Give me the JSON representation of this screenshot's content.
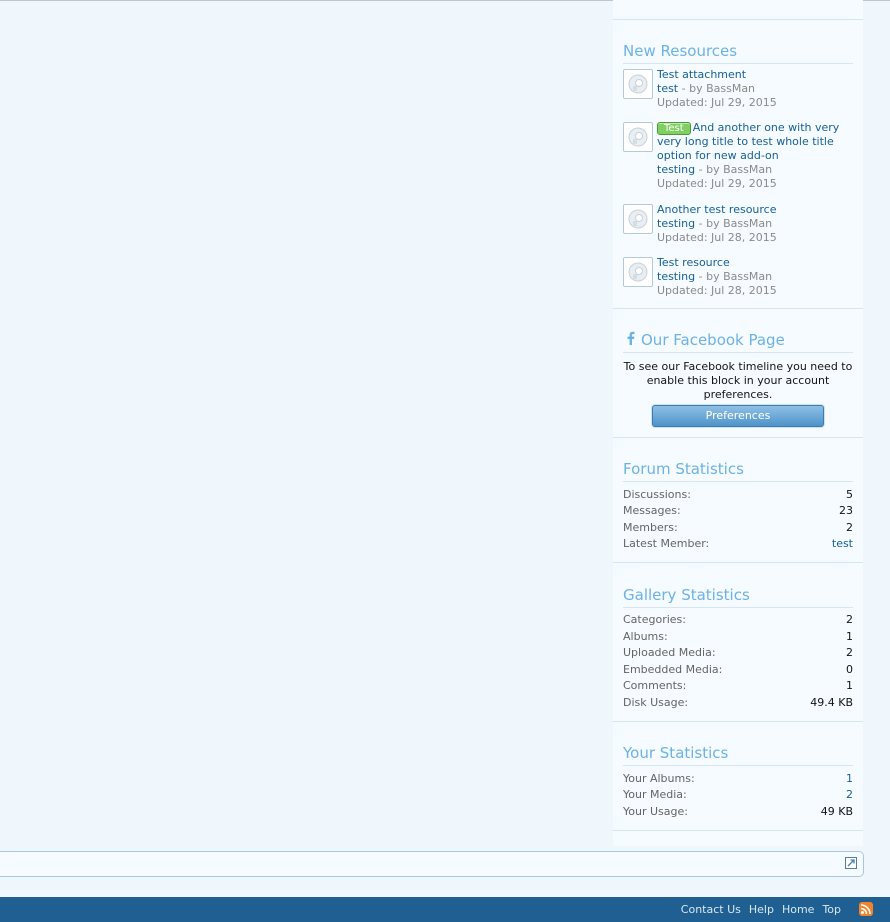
{
  "new_resources": {
    "title": "New Resources",
    "items": [
      {
        "title": "Test attachment",
        "prefix": "",
        "category": "test",
        "author": "- by BassMan",
        "updated": "Updated: Jul 29, 2015"
      },
      {
        "title": "And another one with very very long title to test whole title option for new add-on",
        "prefix": "Test",
        "category": "testing",
        "author": "- by BassMan",
        "updated": "Updated: Jul 29, 2015"
      },
      {
        "title": "Another test resource",
        "prefix": "",
        "category": "testing",
        "author": "- by BassMan",
        "updated": "Updated: Jul 28, 2015"
      },
      {
        "title": "Test resource",
        "prefix": "",
        "category": "testing",
        "author": "- by BassMan",
        "updated": "Updated: Jul 28, 2015"
      }
    ]
  },
  "facebook": {
    "title": "Our Facebook Page",
    "message": "To see our Facebook timeline you need to enable this block in your account preferences.",
    "button": "Preferences"
  },
  "forum_stats": {
    "title": "Forum Statistics",
    "rows": [
      {
        "label": "Discussions:",
        "value": "5"
      },
      {
        "label": "Messages:",
        "value": "23"
      },
      {
        "label": "Members:",
        "value": "2"
      },
      {
        "label": "Latest Member:",
        "value": "test"
      }
    ]
  },
  "gallery_stats": {
    "title": "Gallery Statistics",
    "rows": [
      {
        "label": "Categories:",
        "value": "2"
      },
      {
        "label": "Albums:",
        "value": "1"
      },
      {
        "label": "Uploaded Media:",
        "value": "2"
      },
      {
        "label": "Embedded Media:",
        "value": "0"
      },
      {
        "label": "Comments:",
        "value": "1"
      },
      {
        "label": "Disk Usage:",
        "value": "49.4 KB"
      }
    ]
  },
  "your_stats": {
    "title": "Your Statistics",
    "rows": [
      {
        "label": "Your Albums:",
        "value": "1"
      },
      {
        "label": "Your Media:",
        "value": "2"
      },
      {
        "label": "Your Usage:",
        "value": "49 KB"
      }
    ]
  },
  "footer": {
    "links": [
      "Contact Us",
      "Help",
      "Home",
      "Top"
    ]
  },
  "colors": {
    "heading": "#6cb2e4",
    "link": "#176093",
    "footer_bg": "#1f5f91",
    "prefix_green": "#7fcf62",
    "rss": "#f2832a"
  },
  "icons": {
    "resource_avatar": "default-resource-icon",
    "facebook": "facebook-icon",
    "share": "share-expand-icon",
    "rss": "rss-icon"
  }
}
